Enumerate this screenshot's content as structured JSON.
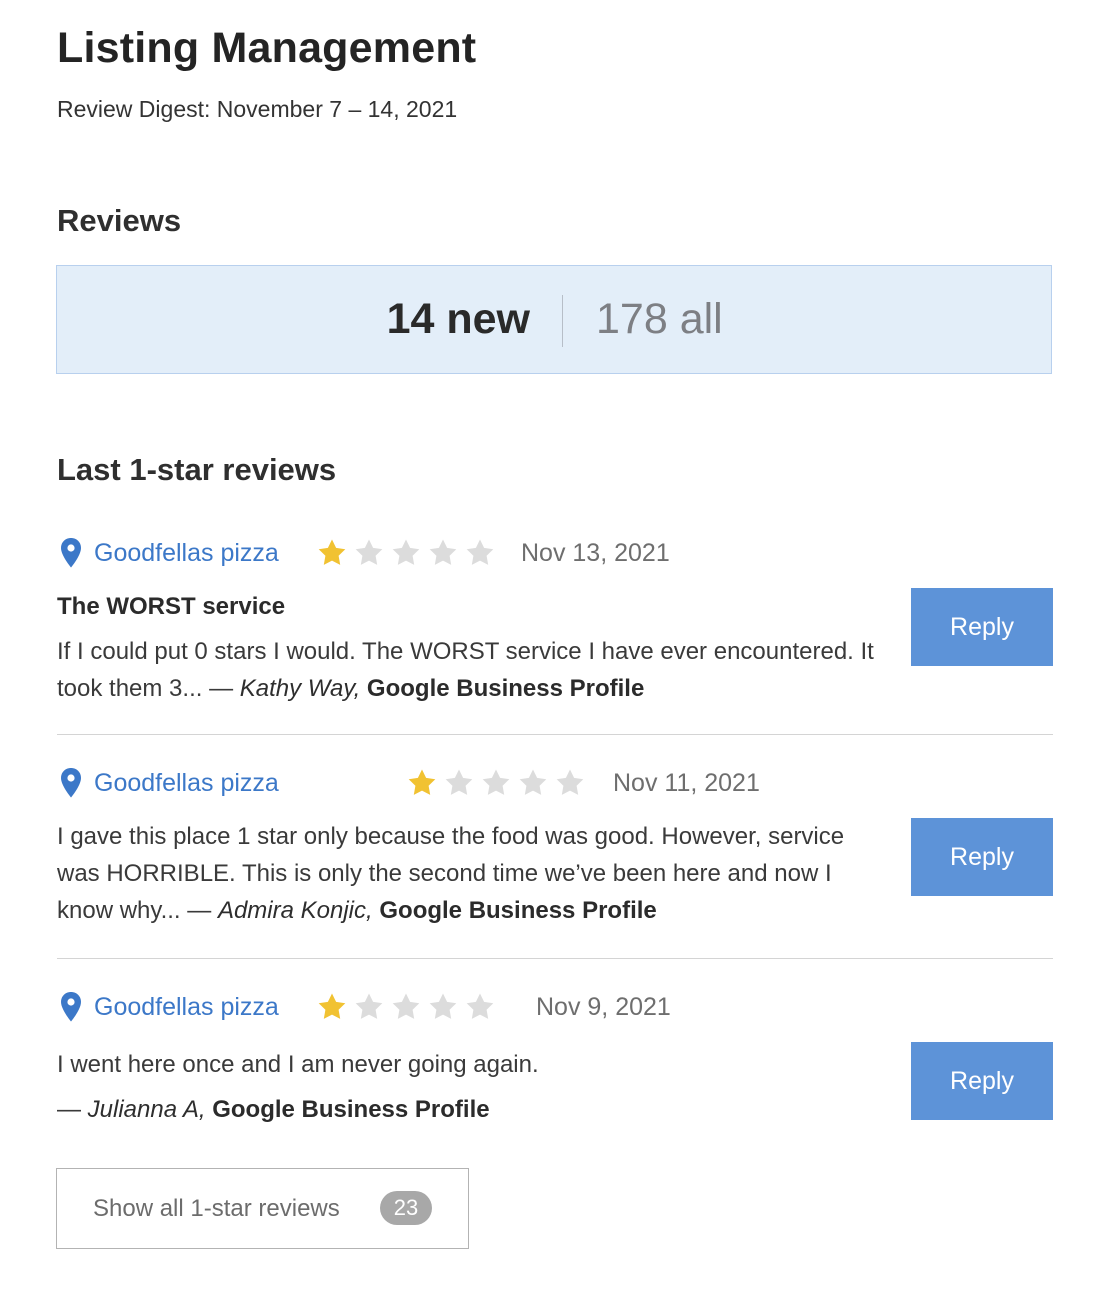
{
  "header": {
    "title": "Listing Management",
    "digest": "Review Digest: November 7 – 14, 2021"
  },
  "reviews_section": {
    "heading": "Reviews",
    "new_count": "14 new",
    "all_count": "178 all"
  },
  "one_star_section": {
    "heading": "Last 1-star reviews",
    "reviews": [
      {
        "place": "Goodfellas pizza",
        "rating": 1,
        "max_rating": 5,
        "date": "Nov 13, 2021",
        "title": "The WORST service",
        "text": "If I could put 0 stars I would. The WORST service I have ever encountered. It took them 3...",
        "dash": "—",
        "author": "Kathy Way,",
        "source": "Google Business Profile",
        "reply_label": "Reply"
      },
      {
        "place": "Goodfellas pizza",
        "rating": 1,
        "max_rating": 5,
        "date": "Nov 11, 2021",
        "title": "",
        "text": "I gave this place 1 star only because the food was good. However, service was HORRIBLE. This is only the second time we’ve been here and now I know why...",
        "dash": "—",
        "author": "Admira Konjic,",
        "source": "Google Business Profile",
        "reply_label": "Reply"
      },
      {
        "place": "Goodfellas pizza",
        "rating": 1,
        "max_rating": 5,
        "date": "Nov 9, 2021",
        "title": "",
        "text": "I went here once and I am never going again.",
        "dash": "—",
        "author": "Julianna A,",
        "source": "Google Business Profile",
        "reply_label": "Reply"
      }
    ],
    "show_all_label": "Show all 1-star reviews",
    "show_all_count": "23"
  },
  "icons": {
    "pin": "map-pin-icon",
    "star": "star-icon"
  },
  "colors": {
    "link": "#3c78c8",
    "reply_button": "#5d93d8",
    "star_filled": "#f1c232",
    "star_empty": "#dcdcdc",
    "summary_bg": "#e3eef9"
  }
}
